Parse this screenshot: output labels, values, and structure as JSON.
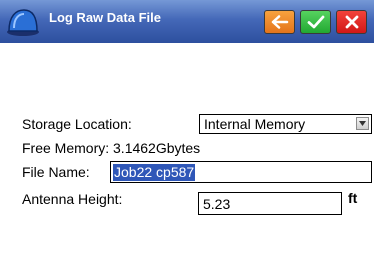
{
  "window": {
    "title": "Log Raw Data File",
    "buttons": {
      "back": "arrow-left-icon",
      "ok": "checkmark-icon",
      "close": "close-x-icon"
    }
  },
  "form": {
    "storage_location": {
      "label": "Storage Location:",
      "value": "Internal Memory"
    },
    "free_memory": "Free Memory: 3.1462Gbytes",
    "file_name": {
      "label": "File Name:",
      "value": "Job22 cp587"
    },
    "antenna_height": {
      "label": "Antenna Height:",
      "value": "5.23",
      "unit": "ft"
    }
  },
  "colors": {
    "titlebar": "#4468b8",
    "back_button": "#f08a2c",
    "ok_button": "#38bf45",
    "close_button": "#e02a24",
    "selection": "#2f57b8"
  }
}
